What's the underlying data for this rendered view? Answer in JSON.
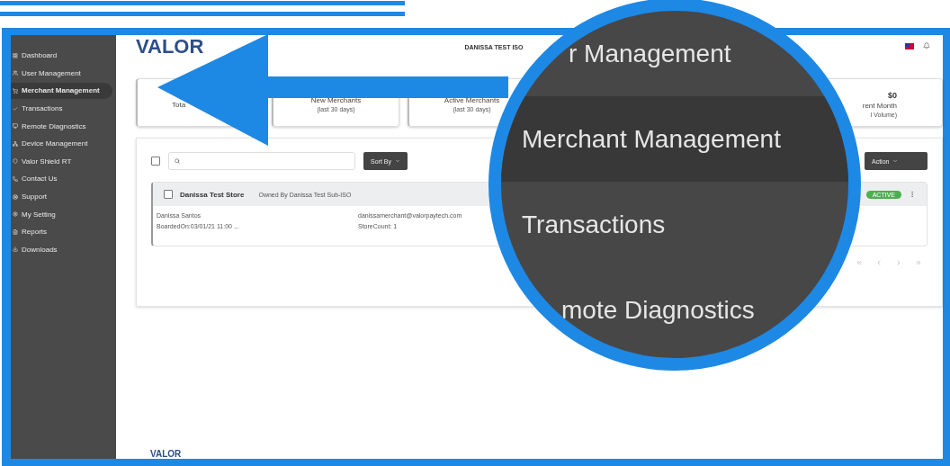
{
  "sidebar": {
    "items": [
      {
        "label": "Dashboard",
        "selected": false
      },
      {
        "label": "User Management",
        "selected": false
      },
      {
        "label": "Merchant Management",
        "selected": true
      },
      {
        "label": "Transactions",
        "selected": false
      },
      {
        "label": "Remote Diagnostics",
        "selected": false
      },
      {
        "label": "Device Management",
        "selected": false
      },
      {
        "label": "Valor Shield RT",
        "selected": false
      },
      {
        "label": "Contact Us",
        "selected": false
      },
      {
        "label": "Support",
        "selected": false
      },
      {
        "label": "My Setting",
        "selected": false
      },
      {
        "label": "Reports",
        "selected": false
      },
      {
        "label": "Downloads",
        "selected": false
      }
    ]
  },
  "header": {
    "logo": "VALOR",
    "account": "DANISSA TEST ISO"
  },
  "stat_cards": [
    {
      "label": "Tota"
    },
    {
      "label": "New Merchants",
      "sub": "(last 30 days)"
    },
    {
      "label": "Active Merchants",
      "sub": "(last 30 days)"
    },
    {
      "value": "$0",
      "label": "rent Month",
      "sub": "l Volume)"
    }
  ],
  "toolbar": {
    "select_all_checked": false,
    "sort_button": "Sort By",
    "action_button": "Action"
  },
  "merchants": [
    {
      "store": "Danissa Test Store",
      "owner": "Owned By Danissa Test Sub-ISO",
      "status": "ACTIVE",
      "checked": false,
      "contact": "Danissa Santos",
      "boarded": "BoardedOn:03/01/21 11:00 ...",
      "email": "danissamerchant@valorpaytech.com",
      "store_count": "StoreCount: 1"
    }
  ],
  "footer": {
    "logo": "VALOR"
  },
  "magnifier": {
    "items": [
      {
        "label": "r Management",
        "selected": false
      },
      {
        "label": "Merchant Management",
        "selected": true
      },
      {
        "label": "Transactions",
        "selected": false
      },
      {
        "label": "mote Diagnostics",
        "selected": false
      }
    ]
  }
}
